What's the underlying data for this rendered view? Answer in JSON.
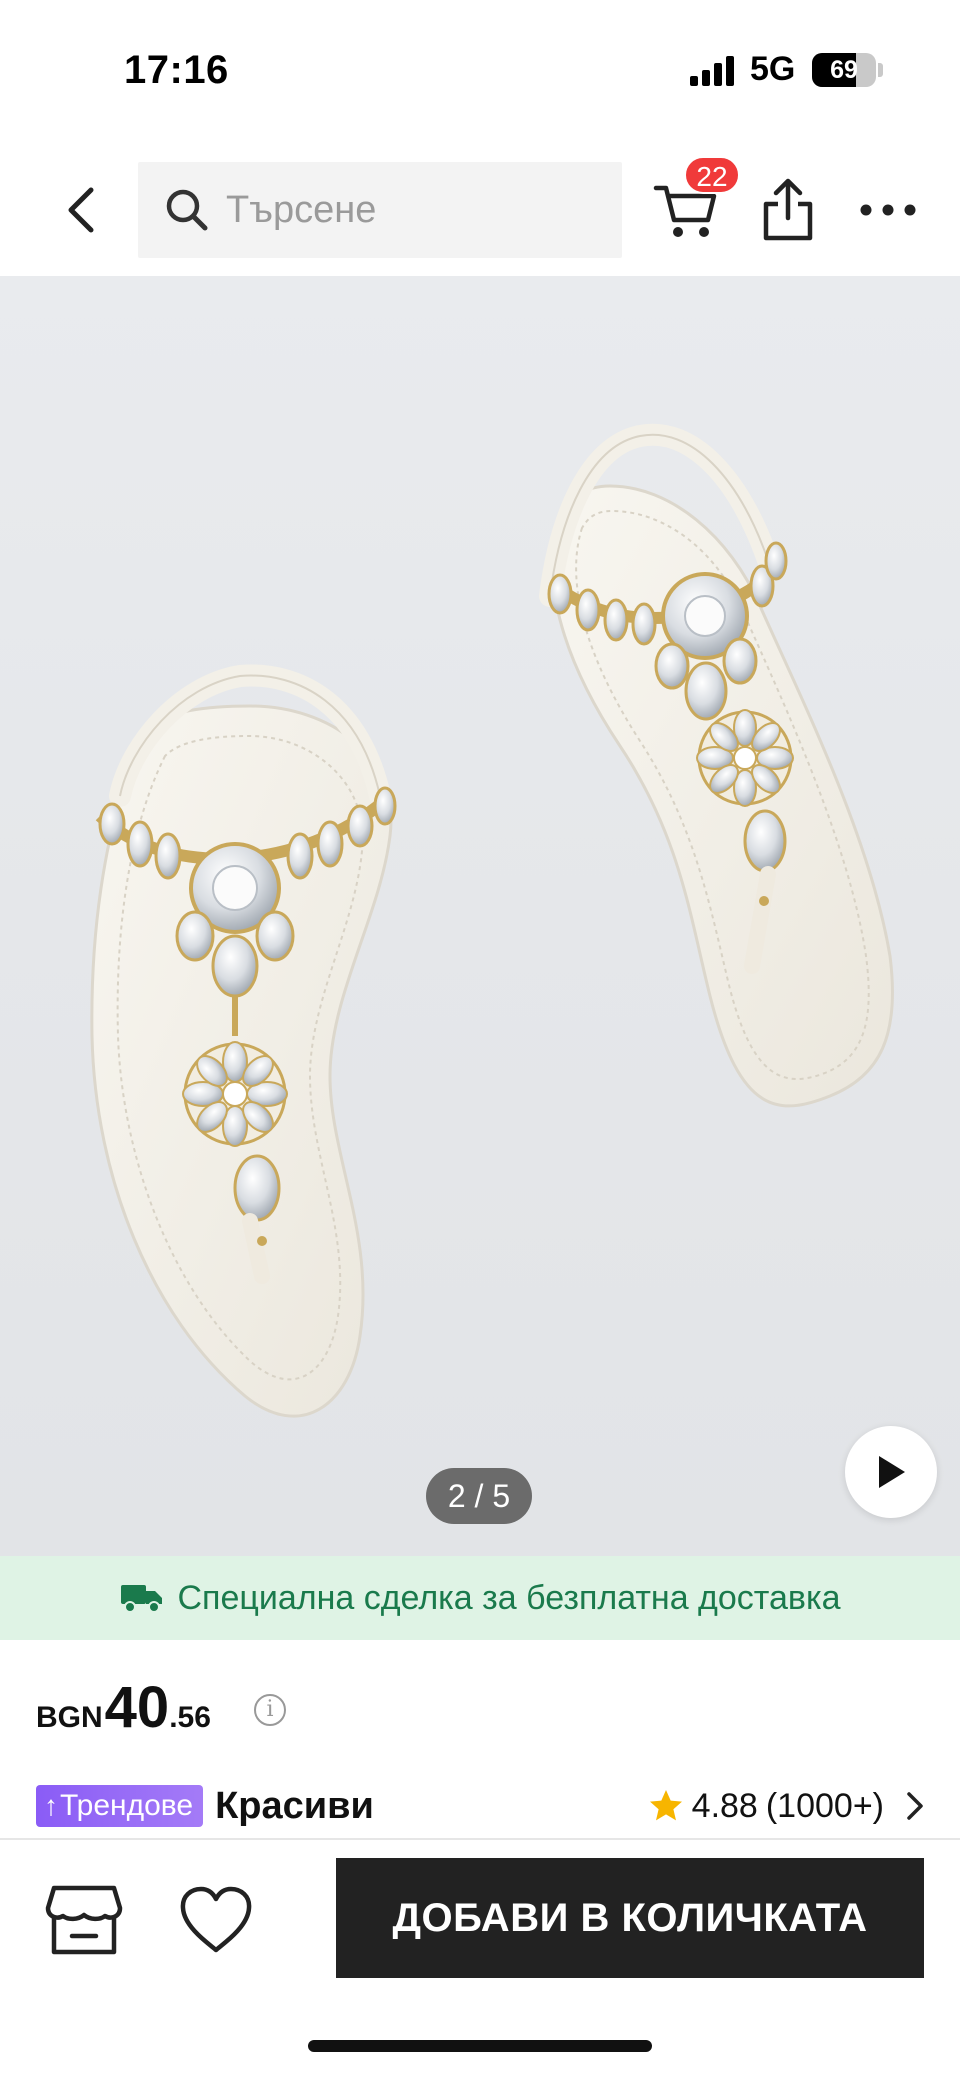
{
  "status_bar": {
    "time": "17:16",
    "network": "5G",
    "battery_level": "69",
    "battery_percent": 69
  },
  "nav": {
    "search_placeholder": "Търсене",
    "cart_count": "22",
    "icons": [
      "back-arrow-icon",
      "search-icon",
      "cart-icon",
      "share-icon",
      "more-icon"
    ]
  },
  "gallery": {
    "page_indicator": "2 / 5",
    "current_page": 2,
    "total_pages": 5
  },
  "shipping_banner": {
    "text": "Специална сделка за безплатна доставка",
    "color": "#1a7a4c",
    "background": "#dff3e5"
  },
  "price": {
    "currency": "BGN",
    "integer": "40",
    "decimal": ".56"
  },
  "product": {
    "tag": "Трендове",
    "tag_arrow": "↑",
    "name": "Красиви",
    "rating": "4.88",
    "review_count": "(1000+)"
  },
  "bottom_bar": {
    "add_to_cart_label": "ДОБАВИ В КОЛИЧКАТА"
  },
  "colors": {
    "accent_badge": "#f03a3a",
    "trend_tag": "#8a5cf6",
    "star": "#f7b500",
    "cta_background": "#222222"
  }
}
